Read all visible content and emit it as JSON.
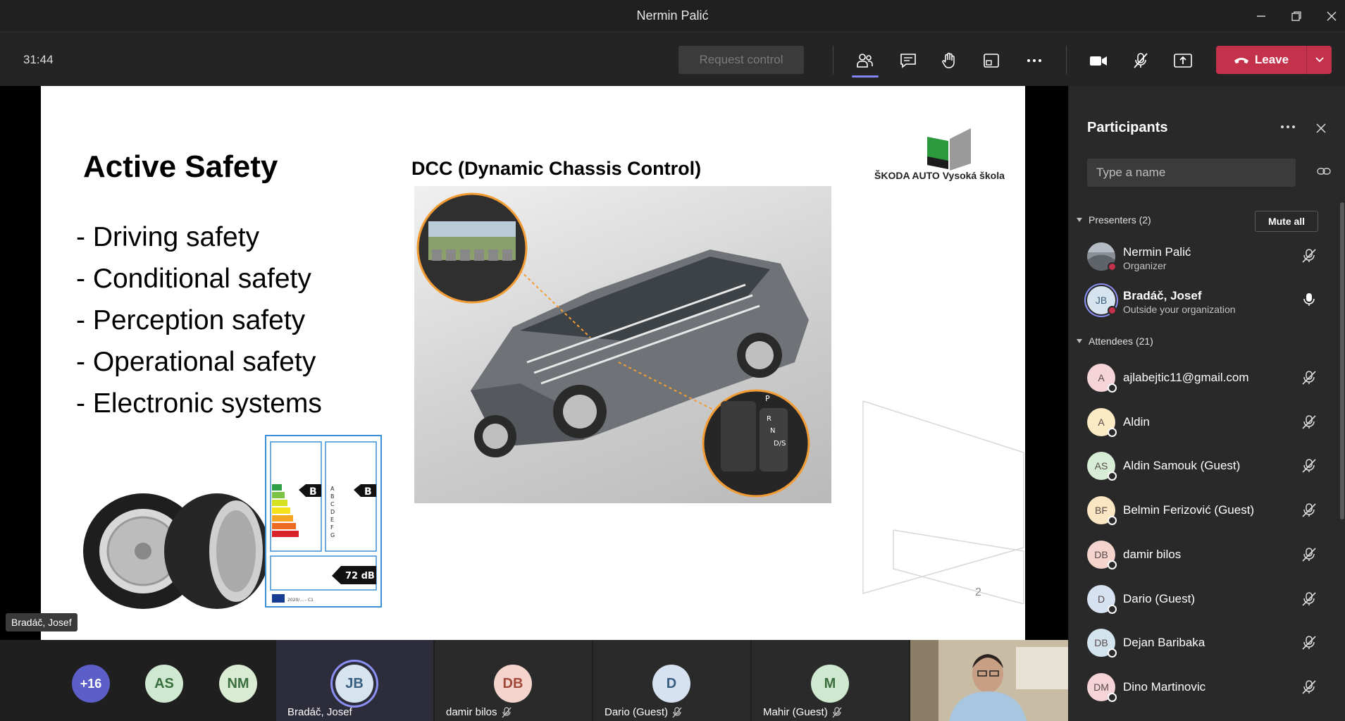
{
  "window": {
    "title": "Nermin Palić"
  },
  "toolbar": {
    "timer": "31:44",
    "request_control": "Request control",
    "leave_label": "Leave"
  },
  "slide": {
    "title": "Active Safety",
    "bullets": [
      "- Driving safety",
      "- Conditional safety",
      "- Perception safety",
      "- Operational safety",
      "- Electronic systems"
    ],
    "dcc_title": "DCC (Dynamic Chassis Control)",
    "logo_text": "ŠKODA AUTO Vysoká škola",
    "page_number": "2",
    "tyre_label": {
      "grade_fuel": "B",
      "grade_wet": "B",
      "noise": "72 dB",
      "scale": [
        "A",
        "B",
        "C",
        "D",
        "E",
        "F",
        "G"
      ],
      "regulation": "2020/... - C1"
    },
    "gear_letters": [
      "P",
      "R",
      "N",
      "D/S"
    ]
  },
  "stage": {
    "speaker_name": "Bradáč, Josef"
  },
  "strip": {
    "tiles": [
      {
        "initials": "+16",
        "name": "",
        "color": "#5b5fc7"
      },
      {
        "initials": "AS",
        "name": "",
        "color": "#cfe8d0"
      },
      {
        "initials": "NM",
        "name": "",
        "color": "#d9ecd3"
      },
      {
        "initials": "JB",
        "name": "Bradáč, Josef",
        "color": "#d6e4ef"
      },
      {
        "initials": "DB",
        "name": "damir bilos",
        "color": "#f4d4cc"
      },
      {
        "initials": "D",
        "name": "Dario (Guest)",
        "color": "#d6e2f2"
      },
      {
        "initials": "M",
        "name": "Mahir (Guest)",
        "color": "#cfe8d0"
      }
    ]
  },
  "participants": {
    "title": "Participants",
    "search_placeholder": "Type a name",
    "presenters_label": "Presenters (2)",
    "mute_all": "Mute all",
    "presenters": [
      {
        "name": "Nermin Palić",
        "role": "Organizer",
        "initials": ""
      },
      {
        "name": "Bradáč, Josef",
        "role": "Outside your organization",
        "initials": "JB"
      }
    ],
    "attendees_label": "Attendees (21)",
    "attendees": [
      {
        "name": "ajlabejtic11@gmail.com",
        "initials": "A",
        "color": "#f4d3d9"
      },
      {
        "name": "Aldin",
        "initials": "A",
        "color": "#fbeac4"
      },
      {
        "name": "Aldin Samouk (Guest)",
        "initials": "AS",
        "color": "#d6ecd4"
      },
      {
        "name": "Belmin Ferizović (Guest)",
        "initials": "BF",
        "color": "#fbe6c4"
      },
      {
        "name": "damir bilos",
        "initials": "DB",
        "color": "#f4d4cc"
      },
      {
        "name": "Dario (Guest)",
        "initials": "D",
        "color": "#d6e2f2"
      },
      {
        "name": "Dejan Baribaka",
        "initials": "DB",
        "color": "#d4e4ef"
      },
      {
        "name": "Dino Martinovic",
        "initials": "DM",
        "color": "#f4d3d9"
      }
    ]
  },
  "colors": {
    "accent": "#7f85f5",
    "leave": "#c4314b",
    "panel": "#292929"
  }
}
